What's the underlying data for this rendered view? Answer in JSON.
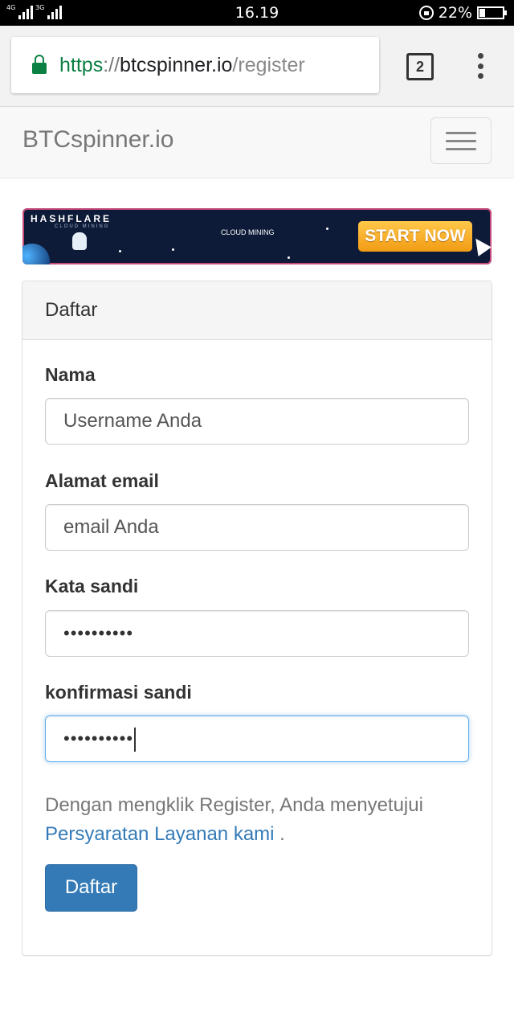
{
  "status_bar": {
    "network_1": "4G",
    "network_2": "3G",
    "time": "16.19",
    "battery": "22%",
    "battery_level": 0.22
  },
  "browser": {
    "url_scheme": "https",
    "url_separator": "://",
    "url_host": "btcspinner.io",
    "url_path": "/register",
    "tab_count": "2"
  },
  "navbar": {
    "brand": "BTCspinner.io"
  },
  "banner": {
    "logo": "HASHFLARE",
    "logo_sub": "CLOUD MINING",
    "center_text": "CLOUD MINING",
    "cta": "START NOW"
  },
  "form": {
    "heading": "Daftar",
    "name_label": "Nama",
    "name_placeholder": "Username Anda",
    "email_label": "Alamat email",
    "email_placeholder": "email Anda",
    "password_label": "Kata sandi",
    "password_value": "••••••••••",
    "confirm_label": "konfirmasi sandi",
    "confirm_value": "••••••••••",
    "terms_text": "Dengan mengklik Register, Anda menyetujui",
    "terms_link": "Persyaratan Layanan kami",
    "terms_end": " .",
    "submit": "Daftar"
  },
  "colors": {
    "primary": "#337ab7",
    "secure_green": "#0b8043",
    "focus_blue": "#66afe9"
  }
}
